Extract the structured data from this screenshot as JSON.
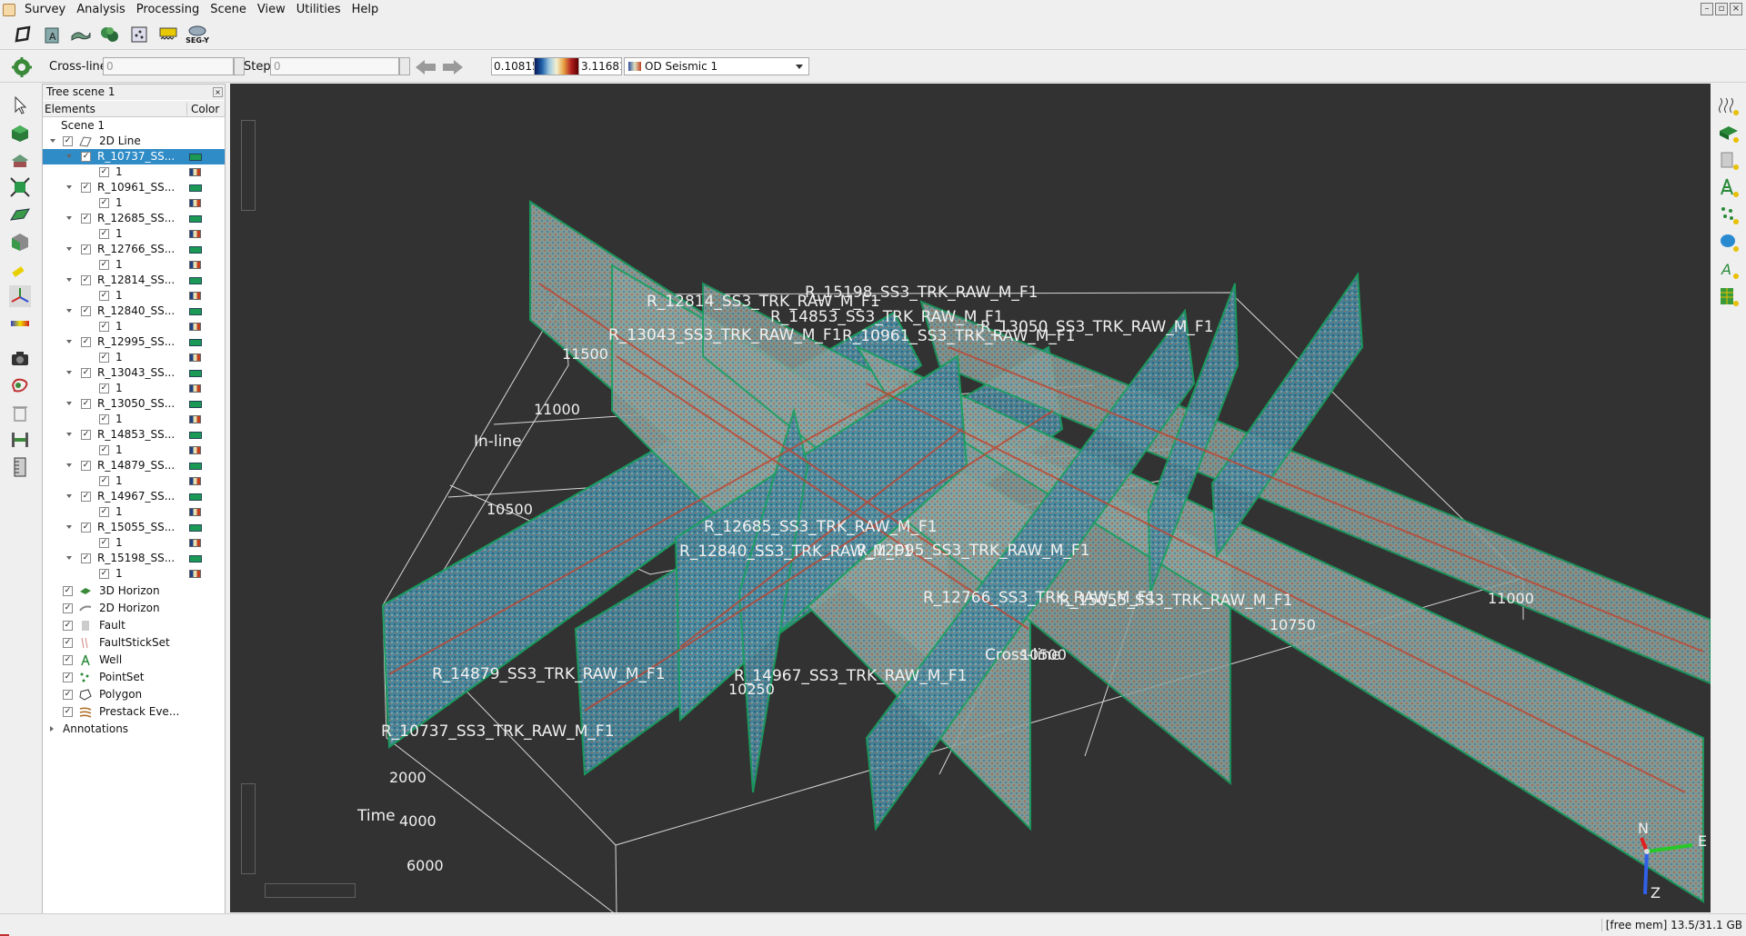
{
  "menubar": {
    "items": [
      "Survey",
      "Analysis",
      "Processing",
      "Scene",
      "View",
      "Utilities",
      "Help"
    ]
  },
  "toolbar": {
    "icons": [
      "survey-manager-icon",
      "attribute-icon",
      "horizon-icon",
      "volume-icon",
      "crossplot-icon",
      "segy-preprocess-icon",
      "segy-icon"
    ],
    "segy_label": "SEG-Y"
  },
  "slice_bar": {
    "crossline_label": "Cross-line",
    "crossline_value": "0",
    "step_label": "Step",
    "step_value": "0",
    "colorbar_min": "0.10815",
    "colorbar_max": "3.11681",
    "attribute_selected": "OD Seismic 1"
  },
  "tree": {
    "title": "Tree scene 1",
    "col_elements": "Elements",
    "col_color": "Color",
    "scene": "Scene 1",
    "group_2dline": "2D Line",
    "lines": [
      {
        "name": "R_10737_SS...",
        "child": "1"
      },
      {
        "name": "R_10961_SS...",
        "child": "1"
      },
      {
        "name": "R_12685_SS...",
        "child": "1"
      },
      {
        "name": "R_12766_SS...",
        "child": "1"
      },
      {
        "name": "R_12814_SS...",
        "child": "1"
      },
      {
        "name": "R_12840_SS...",
        "child": "1"
      },
      {
        "name": "R_12995_SS...",
        "child": "1"
      },
      {
        "name": "R_13043_SS...",
        "child": "1"
      },
      {
        "name": "R_13050_SS...",
        "child": "1"
      },
      {
        "name": "R_14853_SS...",
        "child": "1"
      },
      {
        "name": "R_14879_SS...",
        "child": "1"
      },
      {
        "name": "R_14967_SS...",
        "child": "1"
      },
      {
        "name": "R_15055_SS...",
        "child": "1"
      },
      {
        "name": "R_15198_SS...",
        "child": "1"
      }
    ],
    "groups": [
      "3D Horizon",
      "2D Horizon",
      "Fault",
      "FaultStickSet",
      "Well",
      "PointSet",
      "Polygon",
      "Prestack Eve..."
    ],
    "annotations": "Annotations"
  },
  "viewport": {
    "line_labels": [
      "R_15198_SS3_TRK_RAW_M_F1",
      "R_12814_SS3_TRK_RAW_M_F1",
      "R_14853_SS3_TRK_RAW_M_F1",
      "R_13043_SS3_TRK_RAW_M_F1",
      "R_10961_SS3_TRK_RAW_M_F1",
      "R_13050_SS3_TRK_RAW_M_F1",
      "R_12685_SS3_TRK_RAW_M_F1",
      "R_12840_SS3_TRK_RAW_M_F1",
      "R_12995_SS3_TRK_RAW_M_F1",
      "R_12766_SS3_TRK_RAW_M_F1",
      "R_15055_SS3_TRK_RAW_M_F1",
      "R_14879_SS3_TRK_RAW_M_F1",
      "R_14967_SS3_TRK_RAW_M_F1",
      "R_10737_SS3_TRK_RAW_M_F1"
    ],
    "axis_inline": "In-line",
    "axis_crossline": "Cross-line",
    "axis_time": "Time",
    "inline_ticks": [
      "11500",
      "11000",
      "10500"
    ],
    "crossline_ticks": [
      "11000",
      "10750",
      "10500",
      "10250"
    ],
    "time_ticks": [
      "2000",
      "4000",
      "6000"
    ],
    "compass": {
      "n": "N",
      "e": "E",
      "z": "Z"
    }
  },
  "status": {
    "memory": "[free mem] 13.5/31.1 GB"
  }
}
